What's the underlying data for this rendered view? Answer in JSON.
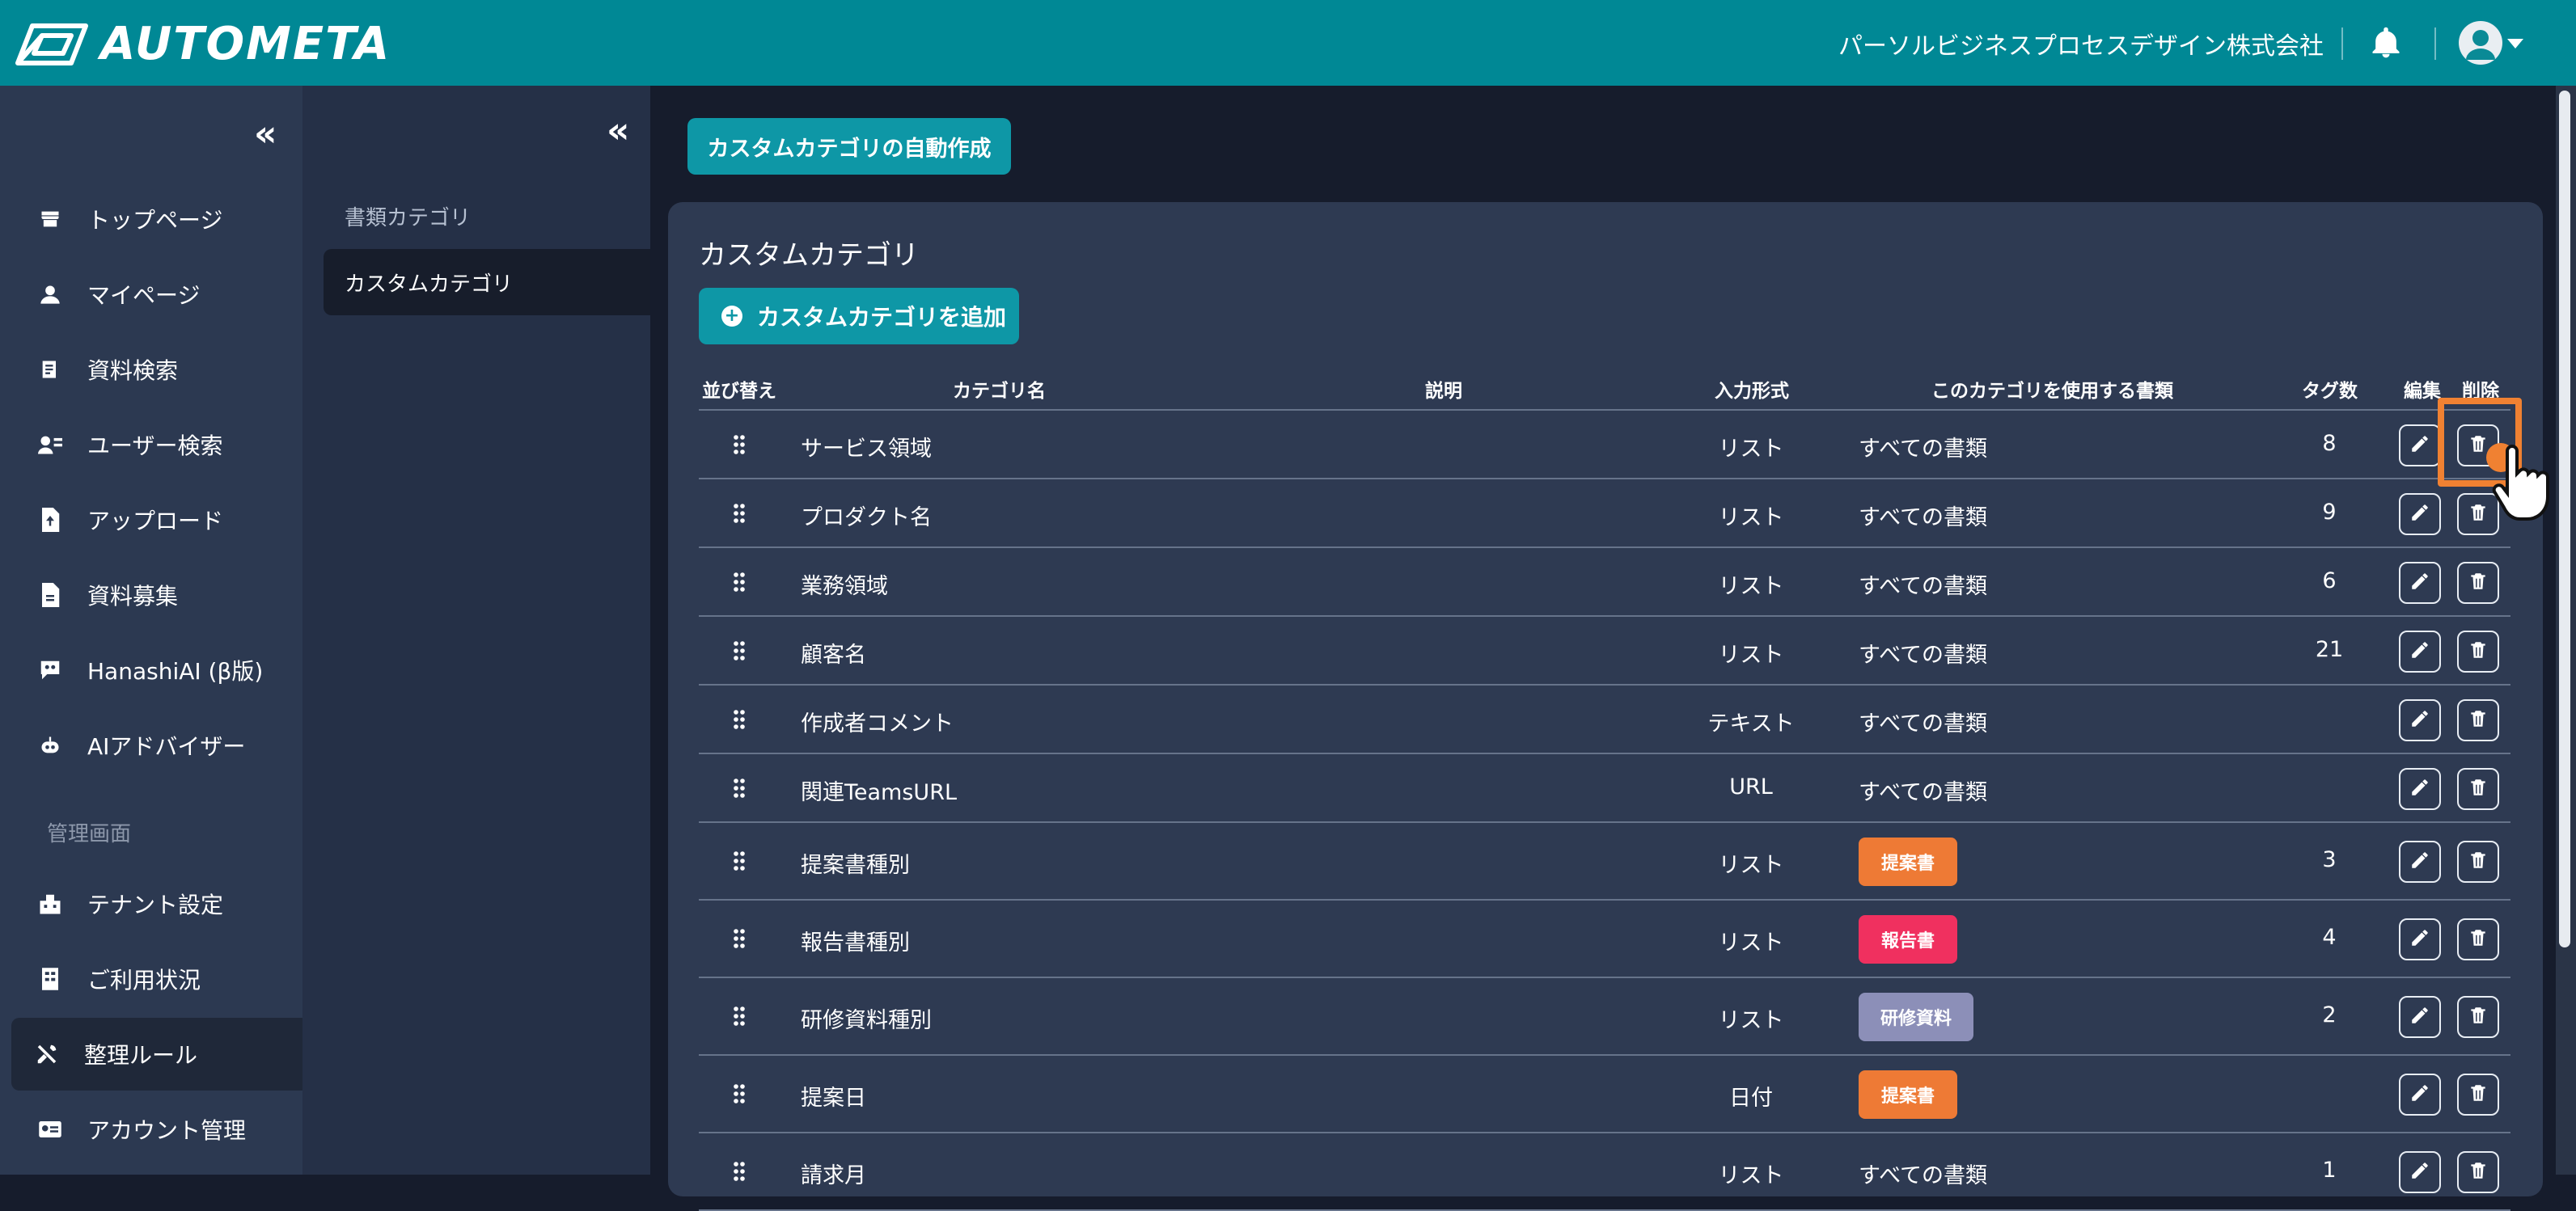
{
  "app": {
    "brand": "AUTOMETA",
    "company": "パーソルビジネスプロセスデザイン株式会社"
  },
  "sidebar": {
    "items": [
      {
        "label": "トップページ",
        "icon": "store-icon"
      },
      {
        "label": "マイページ",
        "icon": "person-icon"
      },
      {
        "label": "資料検索",
        "icon": "document-search-icon"
      },
      {
        "label": "ユーザー検索",
        "icon": "user-search-icon"
      },
      {
        "label": "アップロード",
        "icon": "upload-file-icon"
      },
      {
        "label": "資料募集",
        "icon": "file-icon"
      },
      {
        "label": "HanashiAI (β版)",
        "icon": "chat-bot-icon"
      },
      {
        "label": "AIアドバイザー",
        "icon": "robot-icon"
      }
    ],
    "admin_label": "管理画面",
    "admin_items": [
      {
        "label": "テナント設定",
        "icon": "building-settings-icon"
      },
      {
        "label": "ご利用状況",
        "icon": "usage-building-icon"
      },
      {
        "label": "整理ルール",
        "icon": "tools-icon",
        "active": true
      },
      {
        "label": "アカウント管理",
        "icon": "id-card-icon"
      }
    ]
  },
  "subnav": {
    "items": [
      {
        "label": "書類カテゴリ",
        "active": false
      },
      {
        "label": "カスタムカテゴリ",
        "active": true
      }
    ]
  },
  "main": {
    "auto_create_button": "カスタムカテゴリの自動作成",
    "card_title": "カスタムカテゴリ",
    "add_button": "カスタムカテゴリを追加",
    "columns": [
      "並び替え",
      "カテゴリ名",
      "説明",
      "入力形式",
      "このカテゴリを使用する書類",
      "タグ数",
      "編集",
      "削除"
    ],
    "rows": [
      {
        "name": "サービス領域",
        "desc": "",
        "type": "リスト",
        "docs": "すべての書類",
        "badge": null,
        "tags": "8"
      },
      {
        "name": "プロダクト名",
        "desc": "",
        "type": "リスト",
        "docs": "すべての書類",
        "badge": null,
        "tags": "9"
      },
      {
        "name": "業務領域",
        "desc": "",
        "type": "リスト",
        "docs": "すべての書類",
        "badge": null,
        "tags": "6"
      },
      {
        "name": "顧客名",
        "desc": "",
        "type": "リスト",
        "docs": "すべての書類",
        "badge": null,
        "tags": "21"
      },
      {
        "name": "作成者コメント",
        "desc": "",
        "type": "テキスト",
        "docs": "すべての書類",
        "badge": null,
        "tags": ""
      },
      {
        "name": "関連TeamsURL",
        "desc": "",
        "type": "URL",
        "docs": "すべての書類",
        "badge": null,
        "tags": ""
      },
      {
        "name": "提案書種別",
        "desc": "",
        "type": "リスト",
        "docs": "",
        "badge": {
          "label": "提案書",
          "color": "#ee7a35"
        },
        "tags": "3"
      },
      {
        "name": "報告書種別",
        "desc": "",
        "type": "リスト",
        "docs": "",
        "badge": {
          "label": "報告書",
          "color": "#f0305f"
        },
        "tags": "4"
      },
      {
        "name": "研修資料種別",
        "desc": "",
        "type": "リスト",
        "docs": "",
        "badge": {
          "label": "研修資料",
          "color": "#8c8fb8"
        },
        "tags": "2"
      },
      {
        "name": "提案日",
        "desc": "",
        "type": "日付",
        "docs": "",
        "badge": {
          "label": "提案書",
          "color": "#ee7a35"
        },
        "tags": ""
      },
      {
        "name": "請求月",
        "desc": "",
        "type": "リスト",
        "docs": "すべての書類",
        "badge": null,
        "tags": "1"
      }
    ]
  },
  "colors": {
    "header": "#008895",
    "accent": "#0e97a6",
    "highlight": "#f08132"
  }
}
